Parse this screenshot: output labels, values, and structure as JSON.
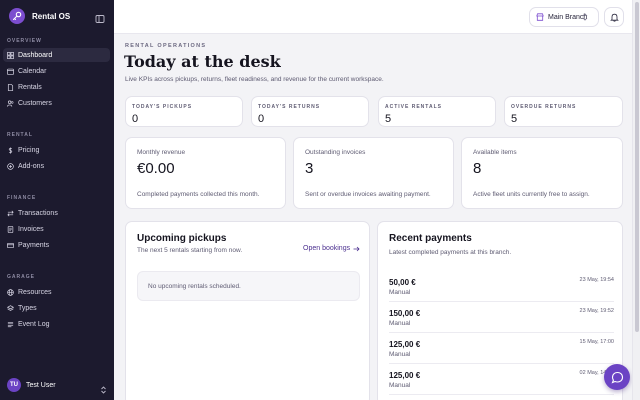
{
  "app": {
    "name": "Rental OS",
    "brand_color": "#7c4dcf"
  },
  "sidebar": {
    "sections": [
      {
        "label": "OVERVIEW",
        "items": [
          {
            "label": "Dashboard",
            "icon": "grid-icon",
            "active": true
          },
          {
            "label": "Calendar",
            "icon": "calendar-icon"
          },
          {
            "label": "Rentals",
            "icon": "document-icon"
          },
          {
            "label": "Customers",
            "icon": "users-icon"
          }
        ]
      },
      {
        "label": "RENTAL",
        "items": [
          {
            "label": "Pricing",
            "icon": "dollar-icon"
          },
          {
            "label": "Add-ons",
            "icon": "plus-circle-icon"
          }
        ]
      },
      {
        "label": "FINANCE",
        "items": [
          {
            "label": "Transactions",
            "icon": "transactions-icon"
          },
          {
            "label": "Invoices",
            "icon": "invoice-icon"
          },
          {
            "label": "Payments",
            "icon": "card-icon"
          }
        ]
      },
      {
        "label": "GARAGE",
        "items": [
          {
            "label": "Resources",
            "icon": "globe-icon"
          },
          {
            "label": "Types",
            "icon": "layers-icon"
          },
          {
            "label": "Event Log",
            "icon": "log-icon"
          }
        ]
      }
    ],
    "user": {
      "initials": "TU",
      "name": "Test User"
    }
  },
  "topbar": {
    "branch": "Main Branch"
  },
  "header": {
    "eyebrow": "RENTAL OPERATIONS",
    "title": "Today at the desk",
    "subtitle": "Live KPIs across pickups, returns, fleet readiness, and revenue for the current workspace."
  },
  "kpis": [
    {
      "label": "TODAY'S PICKUPS",
      "value": "0"
    },
    {
      "label": "TODAY'S RETURNS",
      "value": "0"
    },
    {
      "label": "ACTIVE RENTALS",
      "value": "5"
    },
    {
      "label": "OVERDUE RETURNS",
      "value": "5"
    }
  ],
  "stats": [
    {
      "label": "Monthly revenue",
      "value": "€0.00",
      "desc": "Completed payments collected this month."
    },
    {
      "label": "Outstanding invoices",
      "value": "3",
      "desc": "Sent or overdue invoices awaiting payment."
    },
    {
      "label": "Available items",
      "value": "8",
      "desc": "Active fleet units currently free to assign."
    }
  ],
  "pickups": {
    "title": "Upcoming pickups",
    "subtitle": "The next 5 rentals starting from now.",
    "link": "Open bookings",
    "empty": "No upcoming rentals scheduled."
  },
  "payments": {
    "title": "Recent payments",
    "subtitle": "Latest completed payments at this branch.",
    "rows": [
      {
        "amount": "50,00 €",
        "method": "Manual",
        "date": "23 May, 19:54"
      },
      {
        "amount": "150,00 €",
        "method": "Manual",
        "date": "23 May, 19:52"
      },
      {
        "amount": "125,00 €",
        "method": "Manual",
        "date": "15 May, 17:00"
      },
      {
        "amount": "125,00 €",
        "method": "Manual",
        "date": "02 May, 14:00"
      }
    ]
  }
}
